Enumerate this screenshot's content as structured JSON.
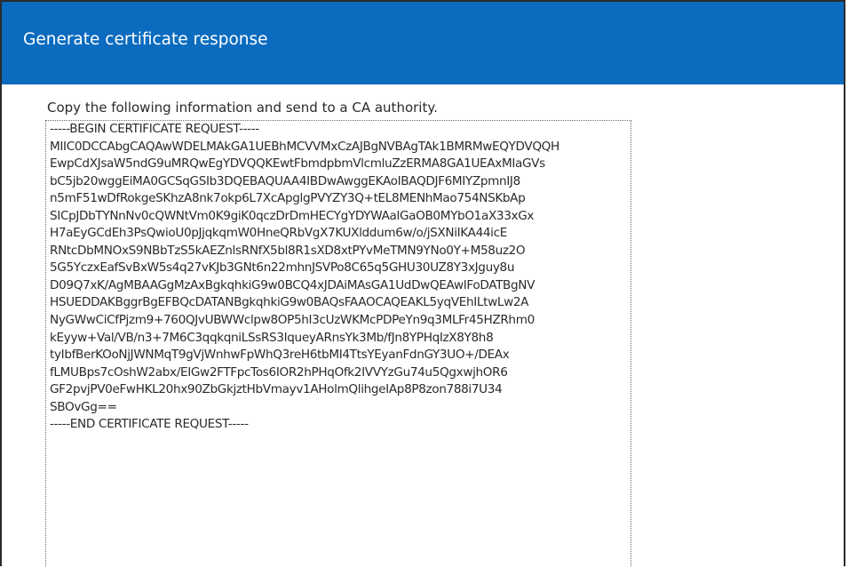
{
  "dialog": {
    "title": "Generate certificate response"
  },
  "instruction": "Copy the following information and send to a CA authority.",
  "csr": "-----BEGIN CERTIFICATE REQUEST-----\nMIIC0DCCAbgCAQAwWDELMAkGA1UEBhMCVVMxCzAJBgNVBAgTAk1BMRMwEQYDVQQH\nEwpCdXJsaW5ndG9uMRQwEgYDVQQKEwtFbmdpbmVlcmluZzERMA8GA1UEAxMIaGVs\nbC5jb20wggEiMA0GCSqGSIb3DQEBAQUAA4IBDwAwggEKAoIBAQDJF6MIYZpmnIJ8\nn5mF51wDfRokgeSKhzA8nk7okp6L7XcApglgPVYZY3Q+tEL8MENhMao754NSKbAp\nSICpJDbTYNnNv0cQWNtVm0K9giK0qczDrDmHECYgYDYWAalGaOB0MYbO1aX33xGx\nH7aEyGCdEh3PsQwioU0pJjqkqmW0HneQRbVgX7KUXlddum6w/o/jSXNiIKA44icE\nRNtcDbMNOxS9NBbTzS5kAEZnlsRNfX5bl8R1sXD8xtPYvMeTMN9YNo0Y+M58uz2O\n5G5YczxEafSvBxW5s4q27vKJb3GNt6n22mhnJSVPo8C65q5GHU30UZ8Y3xJguy8u\nD09Q7xK/AgMBAAGgMzAxBgkqhkiG9w0BCQ4xJDAiMAsGA1UdDwQEAwIFoDATBgNV\nHSUEDDAKBggrBgEFBQcDATANBgkqhkiG9w0BAQsFAAOCAQEAKL5yqVEhILtwLw2A\nNyGWwCiCfPjzm9+760QJvUBWWclpw8OP5hI3cUzWKMcPDPeYn9q3MLFr45HZRhm0\nkEyyw+Val/VB/n3+7M6C3qqkqniLSsRS3IqueyARnsYk3Mb/fJn8YPHqIzX8Y8h8\ntyIbfBerKOoNjJWNMqT9gVjWnhwFpWhQ3reH6tbMI4TtsYEyanFdnGY3UO+/DEAx\nfLMUBps7cOshW2abx/EIGw2FTFpcTos6IOR2hPHqOfk2IVVYzGu74u5QgxwjhOR6\nGF2pvjPV0eFwHKL20hx90ZbGkjztHbVmayv1AHolmQlihgeIAp8P8zon788i7U34\nSBOvGg==\n-----END CERTIFICATE REQUEST-----"
}
